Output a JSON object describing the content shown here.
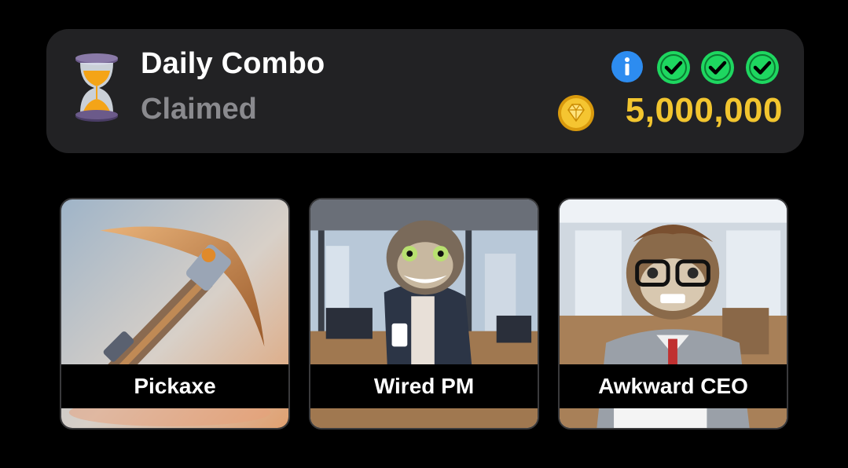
{
  "daily_combo": {
    "title": "Daily Combo",
    "status": "Claimed",
    "reward": "5,000,000",
    "hourglass_icon": "hourglass-icon",
    "info_icon": "info-icon",
    "check_icons": [
      "check-circle-icon",
      "check-circle-icon",
      "check-circle-icon"
    ],
    "coin_icon": "coin-icon",
    "colors": {
      "panel_bg": "#222224",
      "reward": "#f2c52f",
      "check": "#1ed760",
      "info": "#2d8cf0",
      "status": "#8a8a8e"
    }
  },
  "cards": [
    {
      "label": "Pickaxe"
    },
    {
      "label": "Wired PM"
    },
    {
      "label": "Awkward CEO"
    }
  ]
}
